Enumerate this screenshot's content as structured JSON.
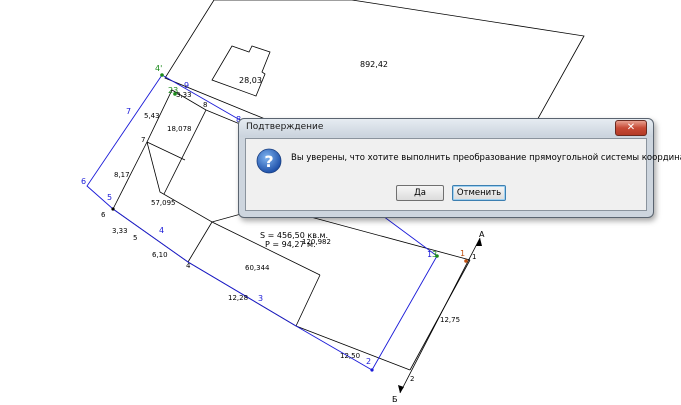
{
  "drawing": {
    "areas": {
      "a1": "892,42",
      "a2": "28,03",
      "a3": "18,078",
      "a4": "57,095",
      "a5": "60,344"
    },
    "info": {
      "s": "S = 456,50 кв.м.",
      "p": "P = 94,27 м.",
      "extra": "120,982"
    },
    "distances": {
      "d1": "5,43",
      "d2": "8,17",
      "d3": "3,33",
      "d4": "6,10",
      "d5": "12,28",
      "d6": "12,50",
      "d7": "12,75",
      "d8": "3,33"
    },
    "points_black": {
      "p1": "1",
      "p2": "2",
      "p4": "4",
      "p5": "5",
      "p6": "6",
      "p7": "7",
      "p8": "8"
    },
    "points_blue": {
      "b1": "1",
      "b2": "2",
      "b3": "3",
      "b4": "4",
      "b5": "5",
      "b6": "6",
      "b7": "7",
      "b8": "8",
      "b9": "9"
    },
    "points_green": {
      "g23": "23",
      "g4": "4'",
      "g3": "3"
    },
    "points_orange": {
      "o1": "1"
    },
    "markers": {
      "a": "А",
      "b": "Б"
    }
  },
  "dialog": {
    "title": "Подтверждение",
    "close_label": "✕",
    "message": "Вы уверены, что хотите выполнить преобразование прямоугольной системы координат ?",
    "yes_label": "Да",
    "cancel_label": "Отменить"
  },
  "colors": {
    "blue_line": "#1a1ad8",
    "accent_green": "#1a8a1a",
    "dialog_frame": "#cdd5de"
  }
}
